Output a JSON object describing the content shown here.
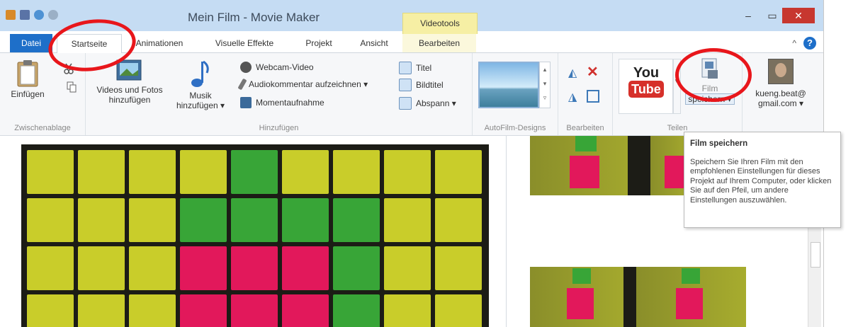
{
  "window": {
    "title": "Mein Film - Movie Maker",
    "context_header": "Videotools",
    "min_glyph": "–",
    "max_glyph": "▭",
    "close_glyph": "✕"
  },
  "tabs": [
    {
      "label": "Datei"
    },
    {
      "label": "Startseite"
    },
    {
      "label": "Animationen"
    },
    {
      "label": "Visuelle Effekte"
    },
    {
      "label": "Projekt"
    },
    {
      "label": "Ansicht"
    },
    {
      "label": "Bearbeiten"
    }
  ],
  "help": {
    "collapse_glyph": "^",
    "help_glyph": "?"
  },
  "ribbon": {
    "clipboard": {
      "paste_label": "Einfügen",
      "group_label": "Zwischenablage"
    },
    "add": {
      "videos_line1": "Videos und Fotos",
      "videos_line2": "hinzufügen",
      "music_line1": "Musik",
      "music_line2": "hinzufügen ▾",
      "webcam": "Webcam-Video",
      "narration": "Audiokommentar aufzeichnen ▾",
      "snapshot": "Momentaufnahme",
      "title": "Titel",
      "caption": "Bildtitel",
      "credits": "Abspann ▾",
      "group_label": "Hinzufügen"
    },
    "autofilm": {
      "group_label": "AutoFilm-Designs"
    },
    "edit": {
      "group_label": "Bearbeiten"
    },
    "share": {
      "youtube_top": "You",
      "youtube_bottom": "Tube",
      "save_line1": "Film",
      "save_line2": "speichern ▾",
      "account_line1": "kueng.beat@",
      "account_line2": "gmail.com ▾",
      "group_label": "Teilen"
    }
  },
  "tooltip": {
    "title": "Film speichern",
    "body": "Speichern Sie Ihren Film mit den empfohlenen Einstellungen für dieses Projekt auf Ihrem Computer, oder klicken Sie auf den Pfeil, um andere Einstellungen auszuwählen."
  },
  "colors": {
    "accent_blue": "#1e6fc9",
    "context_yellow": "#f6efa4",
    "annotation_red": "#e8161b",
    "note_yellow": "#c9cd2a",
    "note_green": "#38a537",
    "note_pink": "#e2185b"
  },
  "icons": [
    "app-icon",
    "save-icon",
    "undo-icon",
    "redo-icon",
    "paste-icon",
    "cut-icon",
    "copy-icon",
    "add-videos-icon",
    "music-note-icon",
    "webcam-icon",
    "microphone-icon",
    "snapshot-icon",
    "title-icon",
    "caption-icon",
    "credits-icon",
    "rotate-left-icon",
    "remove-icon",
    "rotate-right-icon",
    "select-all-icon",
    "youtube-icon",
    "save-movie-icon",
    "account-avatar-icon"
  ]
}
